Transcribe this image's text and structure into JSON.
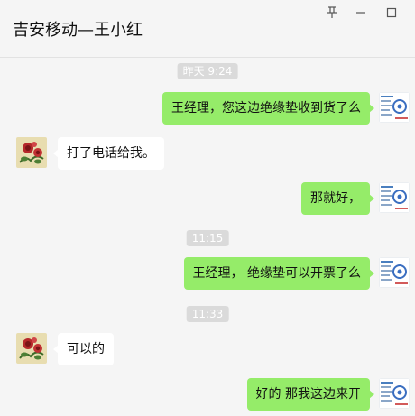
{
  "window": {
    "title": "吉安移动—王小红",
    "controls": [
      "pin-icon",
      "minimize-icon",
      "maximize-icon"
    ]
  },
  "colors": {
    "background": "#f5f5f5",
    "my_bubble": "#95ec69",
    "their_bubble": "#ffffff",
    "timestamp_bg": "#dadada"
  },
  "messages": [
    {
      "type": "time",
      "text": "昨天 9:24"
    },
    {
      "type": "msg",
      "sender": "me",
      "text": "王经理，您这边绝缘垫收到货了么"
    },
    {
      "type": "msg",
      "sender": "other",
      "text": "打了电话给我。"
    },
    {
      "type": "msg",
      "sender": "me",
      "text": "那就好，"
    },
    {
      "type": "time",
      "text": "11:15"
    },
    {
      "type": "msg",
      "sender": "me",
      "text": "王经理， 绝缘垫可以开票了么"
    },
    {
      "type": "time",
      "text": "11:33"
    },
    {
      "type": "msg",
      "sender": "other",
      "text": "可以的"
    },
    {
      "type": "msg",
      "sender": "me",
      "text": "好的 那我这边来开"
    }
  ]
}
